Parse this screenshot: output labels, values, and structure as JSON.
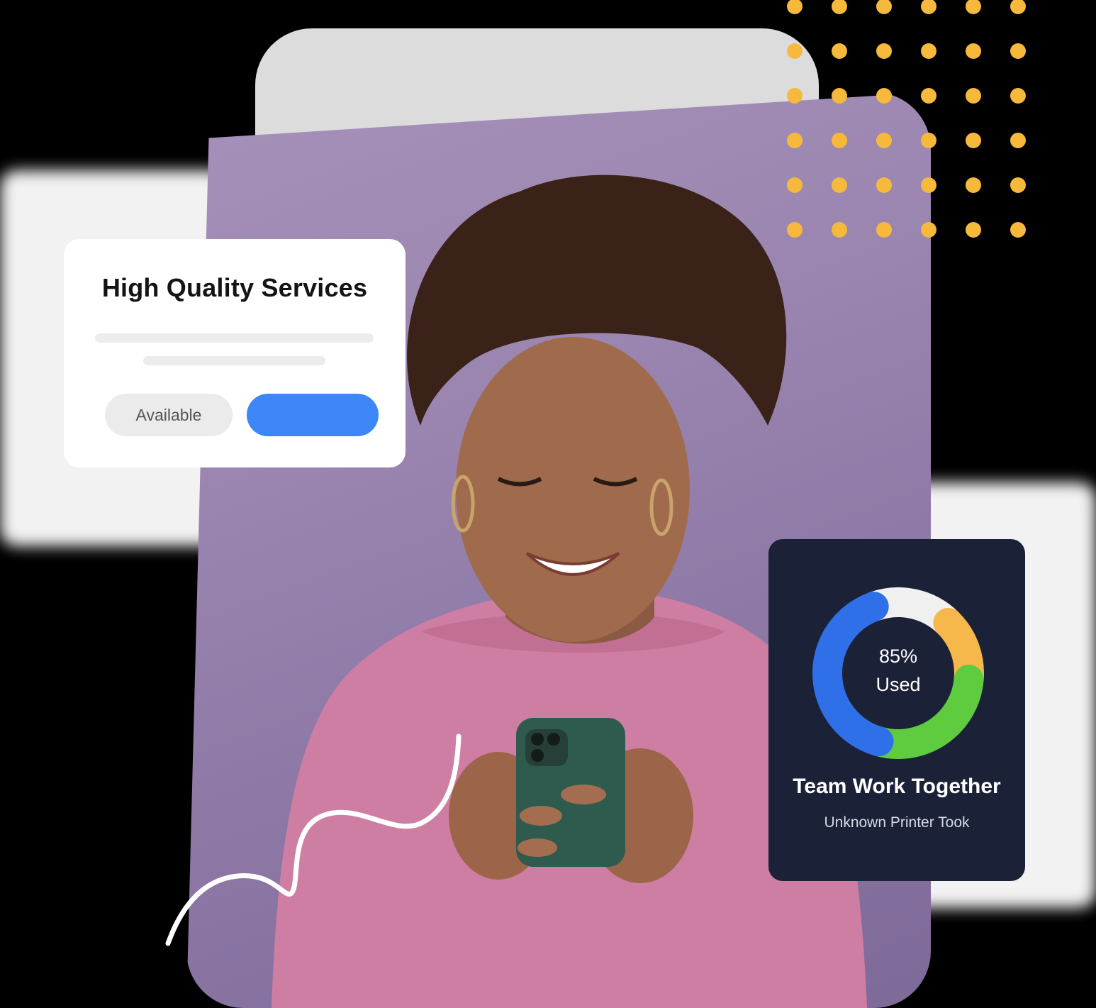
{
  "services_card": {
    "title": "High Quality Services",
    "available_label": "Available",
    "accent_color": "#3d86f7"
  },
  "usage_card": {
    "percent_label": "85%",
    "used_label": "Used",
    "title": "Team Work Together",
    "subtitle": "Unknown Printer Took",
    "percent_value": 85
  },
  "chart_data": {
    "type": "pie",
    "segments": [
      {
        "color": "#f0f0f0",
        "fraction": 0.18
      },
      {
        "color": "#f6b84b",
        "fraction": 0.14
      },
      {
        "color": "#5fcb3f",
        "fraction": 0.28
      },
      {
        "color": "#2f6fe7",
        "fraction": 0.4
      }
    ]
  },
  "photo": {
    "subject": "woman-with-phone",
    "background_color": "#9a85b0",
    "sweater_color": "#cf7ea3",
    "phone_color": "#2f5b4e"
  },
  "decor": {
    "dot_color": "#f6b93b",
    "squiggle_color": "#ffffff"
  }
}
